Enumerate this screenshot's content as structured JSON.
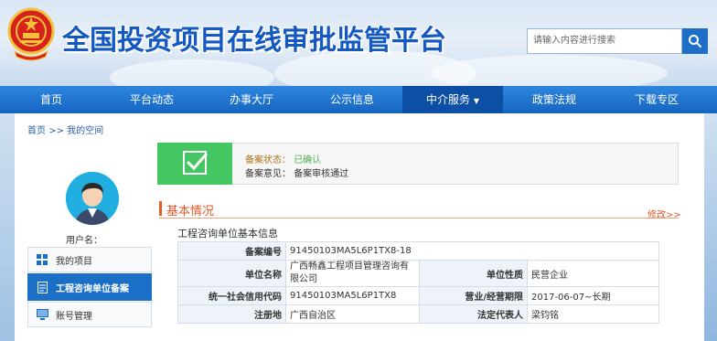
{
  "header": {
    "site_title": "全国投资项目在线审批监管平台",
    "search_placeholder": "请输入内容进行搜索"
  },
  "nav": {
    "items": [
      {
        "label": "首页"
      },
      {
        "label": "平台动态"
      },
      {
        "label": "办事大厅"
      },
      {
        "label": "公示信息"
      },
      {
        "label": "中介服务",
        "has_dropdown": true
      },
      {
        "label": "政策法规"
      },
      {
        "label": "下载专区"
      }
    ],
    "active_index": 4
  },
  "breadcrumb": {
    "home": "首页",
    "separator": ">>",
    "current": "我的空间"
  },
  "user": {
    "label": "用户名："
  },
  "side_menu": {
    "items": [
      {
        "label": "我的项目",
        "icon": "grid-icon"
      },
      {
        "label": "工程咨询单位备案",
        "icon": "document-icon",
        "active": true
      },
      {
        "label": "账号管理",
        "icon": "monitor-icon"
      }
    ]
  },
  "status": {
    "state_key": "备案状态：",
    "state_value": "已确认",
    "opinion_key": "备案意见：",
    "opinion_value": "备案审核通过"
  },
  "section": {
    "title": "基本情况",
    "edit_link": "修改>>",
    "subtitle": "工程咨询单位基本信息"
  },
  "table": {
    "rows": [
      {
        "k1": "备案编号",
        "v1": "91450103MA5L6P1TX8-18"
      },
      {
        "k1": "单位名称",
        "v1": "广西畅鑫工程项目管理咨询有限公司",
        "k2": "单位性质",
        "v2": "民营企业"
      },
      {
        "k1": "统一社会信用代码",
        "v1": "91450103MA5L6P1TX8",
        "k2": "营业/经营期限",
        "v2": "2017-06-07~长期"
      },
      {
        "k1": "注册地",
        "v1": "广西自治区",
        "k2": "法定代表人",
        "v2": "梁钧铭"
      }
    ]
  },
  "colors": {
    "nav_blue": "#1565c0",
    "title_blue": "#1359c1",
    "accent_orange": "#e4562a",
    "status_green": "#44c763"
  }
}
